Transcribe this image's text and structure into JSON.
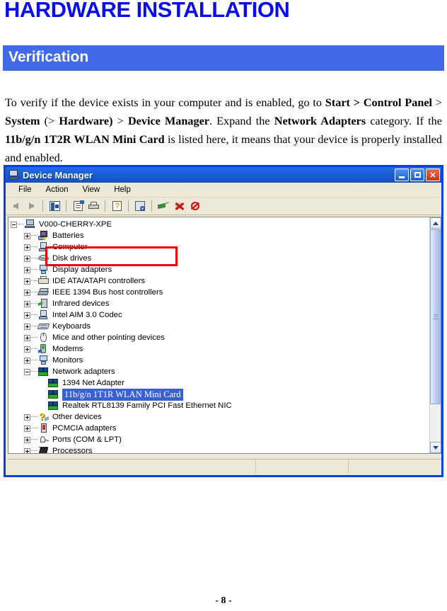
{
  "document": {
    "title": "HARDWARE INSTALLATION",
    "section_heading": "Verification",
    "page_number": "- 8 -",
    "accent_blue": "#0b0bf0",
    "section_bar_color": "#4169e8",
    "paragraph": {
      "t1": "To verify if the device exists in your computer and is enabled, go to ",
      "b1": "Start > Control Panel",
      "t2": " > ",
      "b2": "System",
      "t3": " (> ",
      "b3": "Hardware)",
      "t4": " > ",
      "b4": "Device Manager",
      "t5": ". Expand the ",
      "b5": "Network Adapters",
      "t6": " category. If the ",
      "b6": "11b/g/n 1T2R WLAN Mini Card",
      "t7": " is listed here, it means that your device is properly installed and enabled."
    }
  },
  "device_manager": {
    "window_title": "Device Manager",
    "window_icon": "computer-icon",
    "window_buttons": {
      "minimize": "minimize-button",
      "maximize": "maximize-button",
      "close": "close-button"
    },
    "menu": [
      "File",
      "Action",
      "View",
      "Help"
    ],
    "toolbar_icons": [
      "back-arrow-icon",
      "forward-arrow-icon",
      "show-hide-tree-icon",
      "properties-icon",
      "print-icon",
      "help-icon",
      "scan-for-hardware-changes-icon",
      "update-driver-icon",
      "disable-device-icon",
      "uninstall-device-icon"
    ],
    "tree": [
      {
        "label": "V000-CHERRY-XPE",
        "level": 0,
        "expander": "minus",
        "icon": "computer-root-icon"
      },
      {
        "label": "Batteries",
        "level": 1,
        "expander": "plus",
        "icon": "batteries-icon"
      },
      {
        "label": "Computer",
        "level": 1,
        "expander": "plus",
        "icon": "computer-icon"
      },
      {
        "label": "Disk drives",
        "level": 1,
        "expander": "plus",
        "icon": "disk-drive-icon"
      },
      {
        "label": "Display adapters",
        "level": 1,
        "expander": "plus",
        "icon": "display-adapter-icon"
      },
      {
        "label": "IDE ATA/ATAPI controllers",
        "level": 1,
        "expander": "plus",
        "icon": "ide-controller-icon"
      },
      {
        "label": "IEEE 1394 Bus host controllers",
        "level": 1,
        "expander": "plus",
        "icon": "ieee1394-icon"
      },
      {
        "label": "Infrared devices",
        "level": 1,
        "expander": "plus",
        "icon": "infrared-icon"
      },
      {
        "label": "Intel AIM 3.0 Codec",
        "level": 1,
        "expander": "plus",
        "icon": "codec-icon"
      },
      {
        "label": "Keyboards",
        "level": 1,
        "expander": "plus",
        "icon": "keyboard-icon"
      },
      {
        "label": "Mice and other pointing devices",
        "level": 1,
        "expander": "plus",
        "icon": "mouse-icon"
      },
      {
        "label": "Modems",
        "level": 1,
        "expander": "plus",
        "icon": "modem-icon"
      },
      {
        "label": "Monitors",
        "level": 1,
        "expander": "plus",
        "icon": "monitor-icon"
      },
      {
        "label": "Network adapters",
        "level": 1,
        "expander": "minus",
        "icon": "network-adapter-icon"
      },
      {
        "label": "1394 Net Adapter",
        "level": 2,
        "expander": "none",
        "icon": "network-adapter-icon"
      },
      {
        "label": "11b/g/n 1T1R WLAN Mini Card",
        "level": 2,
        "expander": "none",
        "icon": "network-adapter-icon",
        "selected": true
      },
      {
        "label": "Realtek RTL8139 Family PCI Fast Ethernet NIC",
        "level": 2,
        "expander": "none",
        "icon": "network-adapter-icon"
      },
      {
        "label": "Other devices",
        "level": 1,
        "expander": "plus",
        "icon": "unknown-device-icon"
      },
      {
        "label": "PCMCIA adapters",
        "level": 1,
        "expander": "plus",
        "icon": "pcmcia-icon"
      },
      {
        "label": "Ports (COM & LPT)",
        "level": 1,
        "expander": "plus",
        "icon": "port-icon"
      },
      {
        "label": "Processors",
        "level": 1,
        "expander": "plus",
        "icon": "processor-icon"
      }
    ],
    "selection_color": "#3a5fd8",
    "highlight_box_color": "#ee0000",
    "scrollbar": {
      "up_arrow": "scroll-up-icon",
      "down_arrow": "scroll-down-icon",
      "thumb": "scroll-thumb"
    },
    "status_panes": [
      "",
      "",
      ""
    ]
  }
}
